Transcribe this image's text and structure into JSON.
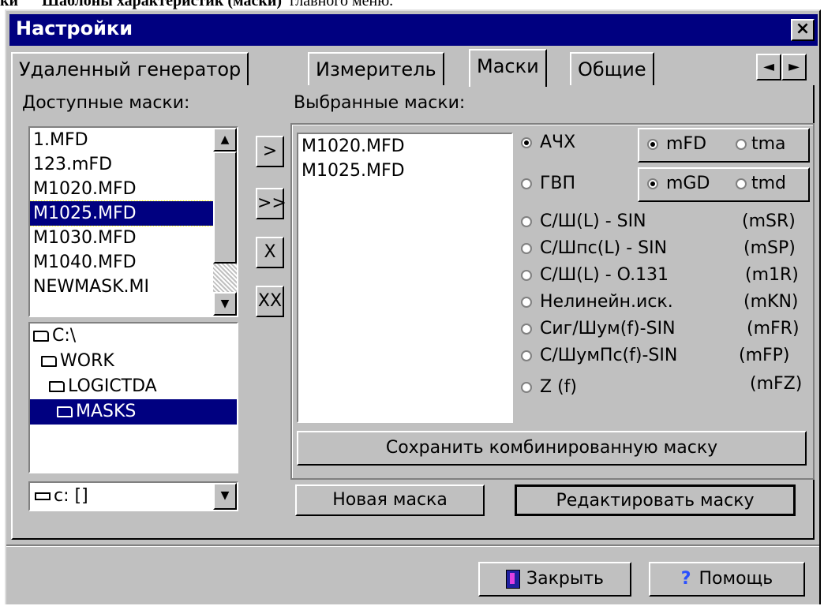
{
  "caption": {
    "part1": "ки",
    "part2": "Шаблоны характеристик (маски)",
    "part3": "главного меню."
  },
  "window": {
    "title": "Настройки",
    "close_label": "×"
  },
  "tabs": [
    {
      "label": "Удаленный генератор"
    },
    {
      "label": "Измеритель"
    },
    {
      "label": "Маски"
    },
    {
      "label": "Общие"
    }
  ],
  "tab_scroll": {
    "left": "◄",
    "right": "►"
  },
  "available": {
    "label": "Доступные маски:",
    "items": [
      "1.MFD",
      "123.mFD",
      "M1020.MFD",
      "M1025.MFD",
      "M1030.MFD",
      "M1040.MFD",
      "NEWMASK.MI"
    ],
    "selected": "M1025.MFD"
  },
  "move_buttons": {
    "add": ">",
    "add_all": ">>",
    "remove": "X",
    "remove_all": "XX"
  },
  "directories": [
    "C:\\",
    "WORK",
    "LOGICTDA",
    "MASKS"
  ],
  "drive": {
    "value": "c: []"
  },
  "selected_masks": {
    "label": "Выбранные маски:",
    "items": [
      "M1020.MFD",
      "M1025.MFD"
    ]
  },
  "mask_types": [
    {
      "label": "АЧХ",
      "code": ""
    },
    {
      "label": "ГВП",
      "code": ""
    },
    {
      "label": "С/Ш(L) - SIN",
      "code": "(mSR)"
    },
    {
      "label": "С/Шпс(L) - SIN",
      "code": "(mSP)"
    },
    {
      "label": "С/Ш(L) - O.131",
      "code": "(m1R)"
    },
    {
      "label": "Нелинейн.иск.",
      "code": "(mKN)"
    },
    {
      "label": "Сиг/Шум(f)-SIN",
      "code": "(mFR)"
    },
    {
      "label": "С/ШумПс(f)-SIN",
      "code": "(mFP)"
    },
    {
      "label": "Z (f)",
      "code": "(mFZ)"
    }
  ],
  "afc_format": {
    "opt1": "mFD",
    "opt2": "tma"
  },
  "gdt_format": {
    "opt1": "mGD",
    "opt2": "tmd"
  },
  "buttons": {
    "save_combined": "Сохранить комбинированную маску",
    "new_mask": "Новая маска",
    "edit_mask": "Редактировать маску",
    "close": "Закрыть",
    "help": "Помощь"
  },
  "colors": {
    "face": "#c0c0c0",
    "title_bar": "#000080",
    "selection": "#000080"
  }
}
